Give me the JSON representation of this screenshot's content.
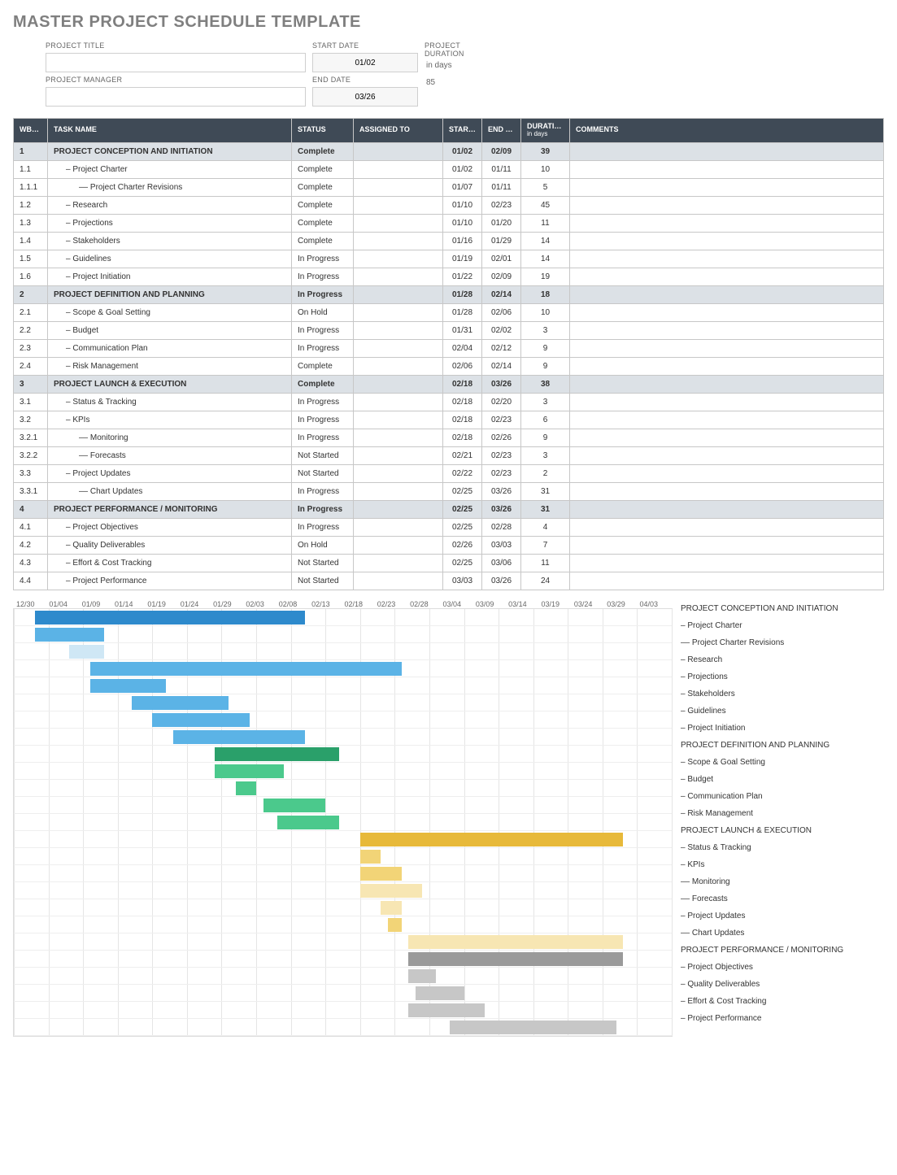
{
  "title": "MASTER PROJECT SCHEDULE TEMPLATE",
  "fields": {
    "project_title_lbl": "PROJECT TITLE",
    "project_title_val": "",
    "project_manager_lbl": "PROJECT MANAGER",
    "project_manager_val": "",
    "start_date_lbl": "START DATE",
    "start_date_val": "01/02",
    "end_date_lbl": "END DATE",
    "end_date_val": "03/26",
    "duration_lbl1": "PROJECT",
    "duration_lbl2": "DURATION",
    "duration_unit": "in days",
    "duration_val": "85"
  },
  "cols": {
    "wbs": "WBS NO.",
    "name": "TASK NAME",
    "status": "STATUS",
    "assigned": "ASSIGNED TO",
    "start": "START DATE",
    "end": "END DATE",
    "dur": "DURATION",
    "dur_sub": "in days",
    "comments": "COMMENTS"
  },
  "rows": [
    {
      "p": 1,
      "w": "1",
      "n": "PROJECT CONCEPTION AND INITIATION",
      "s": "Complete",
      "a": "",
      "sd": "01/02",
      "ed": "02/09",
      "d": "39",
      "c": ""
    },
    {
      "p": 0,
      "w": "1.1",
      "n": "– Project Charter",
      "s": "Complete",
      "a": "",
      "sd": "01/02",
      "ed": "01/11",
      "d": "10",
      "c": ""
    },
    {
      "p": 0,
      "w": "1.1.1",
      "n": "–– Project Charter Revisions",
      "s": "Complete",
      "a": "",
      "sd": "01/07",
      "ed": "01/11",
      "d": "5",
      "c": ""
    },
    {
      "p": 0,
      "w": "1.2",
      "n": "– Research",
      "s": "Complete",
      "a": "",
      "sd": "01/10",
      "ed": "02/23",
      "d": "45",
      "c": ""
    },
    {
      "p": 0,
      "w": "1.3",
      "n": "– Projections",
      "s": "Complete",
      "a": "",
      "sd": "01/10",
      "ed": "01/20",
      "d": "11",
      "c": ""
    },
    {
      "p": 0,
      "w": "1.4",
      "n": "– Stakeholders",
      "s": "Complete",
      "a": "",
      "sd": "01/16",
      "ed": "01/29",
      "d": "14",
      "c": ""
    },
    {
      "p": 0,
      "w": "1.5",
      "n": "– Guidelines",
      "s": "In Progress",
      "a": "",
      "sd": "01/19",
      "ed": "02/01",
      "d": "14",
      "c": ""
    },
    {
      "p": 0,
      "w": "1.6",
      "n": "– Project Initiation",
      "s": "In Progress",
      "a": "",
      "sd": "01/22",
      "ed": "02/09",
      "d": "19",
      "c": ""
    },
    {
      "p": 1,
      "w": "2",
      "n": "PROJECT DEFINITION AND PLANNING",
      "s": "In Progress",
      "a": "",
      "sd": "01/28",
      "ed": "02/14",
      "d": "18",
      "c": ""
    },
    {
      "p": 0,
      "w": "2.1",
      "n": "– Scope & Goal Setting",
      "s": "On Hold",
      "a": "",
      "sd": "01/28",
      "ed": "02/06",
      "d": "10",
      "c": ""
    },
    {
      "p": 0,
      "w": "2.2",
      "n": "– Budget",
      "s": "In Progress",
      "a": "",
      "sd": "01/31",
      "ed": "02/02",
      "d": "3",
      "c": ""
    },
    {
      "p": 0,
      "w": "2.3",
      "n": "– Communication Plan",
      "s": "In Progress",
      "a": "",
      "sd": "02/04",
      "ed": "02/12",
      "d": "9",
      "c": ""
    },
    {
      "p": 0,
      "w": "2.4",
      "n": "– Risk Management",
      "s": "Complete",
      "a": "",
      "sd": "02/06",
      "ed": "02/14",
      "d": "9",
      "c": ""
    },
    {
      "p": 1,
      "w": "3",
      "n": "PROJECT LAUNCH & EXECUTION",
      "s": "Complete",
      "a": "",
      "sd": "02/18",
      "ed": "03/26",
      "d": "38",
      "c": ""
    },
    {
      "p": 0,
      "w": "3.1",
      "n": "– Status & Tracking",
      "s": "In Progress",
      "a": "",
      "sd": "02/18",
      "ed": "02/20",
      "d": "3",
      "c": ""
    },
    {
      "p": 0,
      "w": "3.2",
      "n": "– KPIs",
      "s": "In Progress",
      "a": "",
      "sd": "02/18",
      "ed": "02/23",
      "d": "6",
      "c": ""
    },
    {
      "p": 0,
      "w": "3.2.1",
      "n": "–– Monitoring",
      "s": "In Progress",
      "a": "",
      "sd": "02/18",
      "ed": "02/26",
      "d": "9",
      "c": ""
    },
    {
      "p": 0,
      "w": "3.2.2",
      "n": "–– Forecasts",
      "s": "Not Started",
      "a": "",
      "sd": "02/21",
      "ed": "02/23",
      "d": "3",
      "c": ""
    },
    {
      "p": 0,
      "w": "3.3",
      "n": "– Project Updates",
      "s": "Not Started",
      "a": "",
      "sd": "02/22",
      "ed": "02/23",
      "d": "2",
      "c": ""
    },
    {
      "p": 0,
      "w": "3.3.1",
      "n": "–– Chart Updates",
      "s": "In Progress",
      "a": "",
      "sd": "02/25",
      "ed": "03/26",
      "d": "31",
      "c": ""
    },
    {
      "p": 1,
      "w": "4",
      "n": "PROJECT PERFORMANCE / MONITORING",
      "s": "In Progress",
      "a": "",
      "sd": "02/25",
      "ed": "03/26",
      "d": "31",
      "c": ""
    },
    {
      "p": 0,
      "w": "4.1",
      "n": "– Project Objectives",
      "s": "In Progress",
      "a": "",
      "sd": "02/25",
      "ed": "02/28",
      "d": "4",
      "c": ""
    },
    {
      "p": 0,
      "w": "4.2",
      "n": "– Quality Deliverables",
      "s": "On Hold",
      "a": "",
      "sd": "02/26",
      "ed": "03/03",
      "d": "7",
      "c": ""
    },
    {
      "p": 0,
      "w": "4.3",
      "n": "– Effort & Cost Tracking",
      "s": "Not Started",
      "a": "",
      "sd": "02/25",
      "ed": "03/06",
      "d": "11",
      "c": ""
    },
    {
      "p": 0,
      "w": "4.4",
      "n": "– Project Performance",
      "s": "Not Started",
      "a": "",
      "sd": "03/03",
      "ed": "03/26",
      "d": "24",
      "c": ""
    }
  ],
  "chart_data": {
    "type": "gantt",
    "x_ticks": [
      "12/30",
      "01/04",
      "01/09",
      "01/14",
      "01/19",
      "01/24",
      "01/29",
      "02/03",
      "02/08",
      "02/13",
      "02/18",
      "02/23",
      "02/28",
      "03/04",
      "03/09",
      "03/14",
      "03/19",
      "03/24",
      "03/29",
      "04/03"
    ],
    "x_range_days": [
      0,
      95
    ],
    "tasks": [
      {
        "name": "PROJECT CONCEPTION AND INITIATION",
        "start_offset": 3,
        "duration": 39,
        "color": "c1"
      },
      {
        "name": "– Project Charter",
        "start_offset": 3,
        "duration": 10,
        "color": "c1l"
      },
      {
        "name": "–– Project Charter Revisions",
        "start_offset": 8,
        "duration": 5,
        "color": "c1ll"
      },
      {
        "name": "– Research",
        "start_offset": 11,
        "duration": 45,
        "color": "c1l"
      },
      {
        "name": "– Projections",
        "start_offset": 11,
        "duration": 11,
        "color": "c1l"
      },
      {
        "name": "– Stakeholders",
        "start_offset": 17,
        "duration": 14,
        "color": "c1l"
      },
      {
        "name": "– Guidelines",
        "start_offset": 20,
        "duration": 14,
        "color": "c1l"
      },
      {
        "name": "– Project Initiation",
        "start_offset": 23,
        "duration": 19,
        "color": "c1l"
      },
      {
        "name": "PROJECT DEFINITION AND PLANNING",
        "start_offset": 29,
        "duration": 18,
        "color": "c2"
      },
      {
        "name": "– Scope & Goal Setting",
        "start_offset": 29,
        "duration": 10,
        "color": "c2l"
      },
      {
        "name": "– Budget",
        "start_offset": 32,
        "duration": 3,
        "color": "c2l"
      },
      {
        "name": "– Communication Plan",
        "start_offset": 36,
        "duration": 9,
        "color": "c2l"
      },
      {
        "name": "– Risk Management",
        "start_offset": 38,
        "duration": 9,
        "color": "c2l"
      },
      {
        "name": "PROJECT LAUNCH & EXECUTION",
        "start_offset": 50,
        "duration": 38,
        "color": "c3"
      },
      {
        "name": "– Status & Tracking",
        "start_offset": 50,
        "duration": 3,
        "color": "c3l"
      },
      {
        "name": "– KPIs",
        "start_offset": 50,
        "duration": 6,
        "color": "c3l"
      },
      {
        "name": "–– Monitoring",
        "start_offset": 50,
        "duration": 9,
        "color": "c3ll"
      },
      {
        "name": "–– Forecasts",
        "start_offset": 53,
        "duration": 3,
        "color": "c3ll"
      },
      {
        "name": "– Project Updates",
        "start_offset": 54,
        "duration": 2,
        "color": "c3l"
      },
      {
        "name": "–– Chart Updates",
        "start_offset": 57,
        "duration": 31,
        "color": "c3ll"
      },
      {
        "name": "PROJECT PERFORMANCE / MONITORING",
        "start_offset": 57,
        "duration": 31,
        "color": "c4"
      },
      {
        "name": "– Project Objectives",
        "start_offset": 57,
        "duration": 4,
        "color": "c4l"
      },
      {
        "name": "– Quality Deliverables",
        "start_offset": 58,
        "duration": 7,
        "color": "c4l"
      },
      {
        "name": "– Effort & Cost Tracking",
        "start_offset": 57,
        "duration": 11,
        "color": "c4l"
      },
      {
        "name": "– Project Performance",
        "start_offset": 63,
        "duration": 24,
        "color": "c4l"
      }
    ]
  }
}
